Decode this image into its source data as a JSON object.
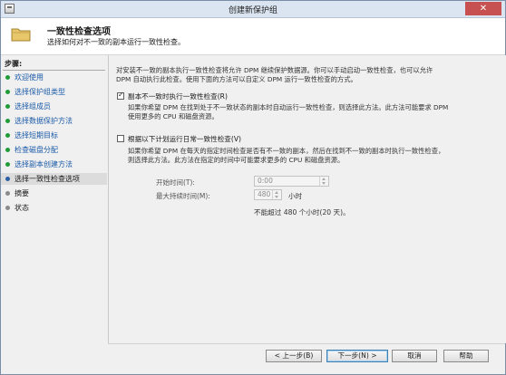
{
  "window": {
    "title": "创建新保护组",
    "close_glyph": "✕"
  },
  "header": {
    "title": "一致性检查选项",
    "subtitle": "选择如何对不一致的副本运行一致性检查。"
  },
  "sidebar": {
    "title": "步骤:",
    "items": [
      {
        "label": "欢迎使用",
        "state": "done"
      },
      {
        "label": "选择保护组类型",
        "state": "done"
      },
      {
        "label": "选择组成员",
        "state": "done"
      },
      {
        "label": "选择数据保护方法",
        "state": "done"
      },
      {
        "label": "选择短期目标",
        "state": "done"
      },
      {
        "label": "检查磁盘分配",
        "state": "done"
      },
      {
        "label": "选择副本创建方法",
        "state": "done"
      },
      {
        "label": "选择一致性检查选项",
        "state": "current"
      },
      {
        "label": "摘要",
        "state": "todo"
      },
      {
        "label": "状态",
        "state": "todo"
      }
    ]
  },
  "content": {
    "intro_line1": "对安装不一致的副本执行一致性检查将允许 DPM 继续保护数据源。你可以手动启动一致性检查，也可以允许",
    "intro_line2": "DPM 自动执行此检查。使用下面的方法可以自定义 DPM 运行一致性检查的方式。",
    "option1": {
      "label": "副本不一致时执行一致性检查(R)",
      "checked": true,
      "desc_line1": "如果你希望 DPM 在找到处于不一致状态的副本时自动运行一致性检查，则选择此方法。此方法可能要求 DPM",
      "desc_line2": "使用更多的 CPU 和磁盘资源。"
    },
    "option2": {
      "label": "根据以下计划运行日常一致性检查(V)",
      "checked": false,
      "desc_line1": "如果你希望 DPM 在每天的指定时间检查是否有不一致的副本，然后在找到不一致的副本时执行一致性检查，",
      "desc_line2": "则选择此方法。此方法在指定的时间中可能要求更多的 CPU 和磁盘资源。"
    },
    "start_time": {
      "label": "开始时间(T):",
      "value": "0:00"
    },
    "max_duration": {
      "label": "最大持续时间(M):",
      "value": "480",
      "unit": "小时"
    },
    "limit_note": "不能超过 480 个小时(20 天)。"
  },
  "buttons": {
    "back": "< 上一步(B)",
    "next": "下一步(N) >",
    "cancel": "取消",
    "help": "帮助"
  }
}
